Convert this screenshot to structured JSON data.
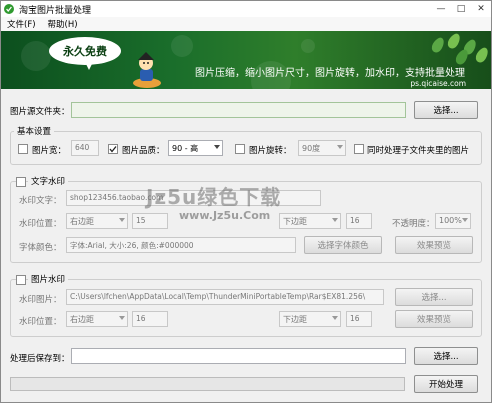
{
  "window": {
    "title": "淘宝图片批量处理",
    "minimize_glyph": "—",
    "maximize_glyph": "□",
    "close_glyph": "✕"
  },
  "menu": [
    "文件(F)",
    "帮助(H)"
  ],
  "banner": {
    "bubble": "永久免费",
    "slogan": "图片压缩，缩小图片尺寸，图片旋转，加水印，支持批量处理",
    "site": "ps.qicaise.com"
  },
  "source": {
    "label": "图片源文件夹：",
    "value": "",
    "browse_label": "选择..."
  },
  "basic": {
    "title": "基本设置",
    "width_label": "图片宽：",
    "width_checked": false,
    "width_value": "640",
    "quality_label": "图片品质：",
    "quality_checked": true,
    "quality_value": "90 - 高",
    "rotate_label": "图片旋转：",
    "rotate_checked": false,
    "rotate_value": "90度",
    "subfolder_label": "同时处理子文件夹里的图片",
    "subfolder_checked": false
  },
  "text_wm": {
    "title": "文字水印",
    "checked": false,
    "text_label": "水印文字：",
    "text_value": "shop123456.taobao.com",
    "pos_label": "水印位置：",
    "h_pos": "右边距",
    "h_offset": "15",
    "v_pos": "下边距",
    "v_offset": "16",
    "opacity_label": "不透明度：",
    "opacity": "100%",
    "font_label": "字体颜色：",
    "font_value": "字体:Arial, 大小:26, 颜色:#000000",
    "font_button": "选择字体颜色",
    "preview_button": "效果预览"
  },
  "image_wm": {
    "title": "图片水印",
    "checked": false,
    "image_label": "水印图片：",
    "image_value": "C:\\Users\\lfchen\\AppData\\Local\\Temp\\ThunderMiniPortableTemp\\Rar$EX81.256\\",
    "browse_label": "选择...",
    "pos_label": "水印位置：",
    "h_pos": "右边距",
    "h_offset": "16",
    "v_pos": "下边距",
    "v_offset": "16",
    "preview_button": "效果预览"
  },
  "output": {
    "label": "处理后保存到：",
    "value": "",
    "browse_label": "选择..."
  },
  "progress": {
    "value": 0
  },
  "start_button": "开始处理",
  "watermark": {
    "main": "Jz5u绿色下载",
    "url": "www.Jz5u.Com"
  }
}
